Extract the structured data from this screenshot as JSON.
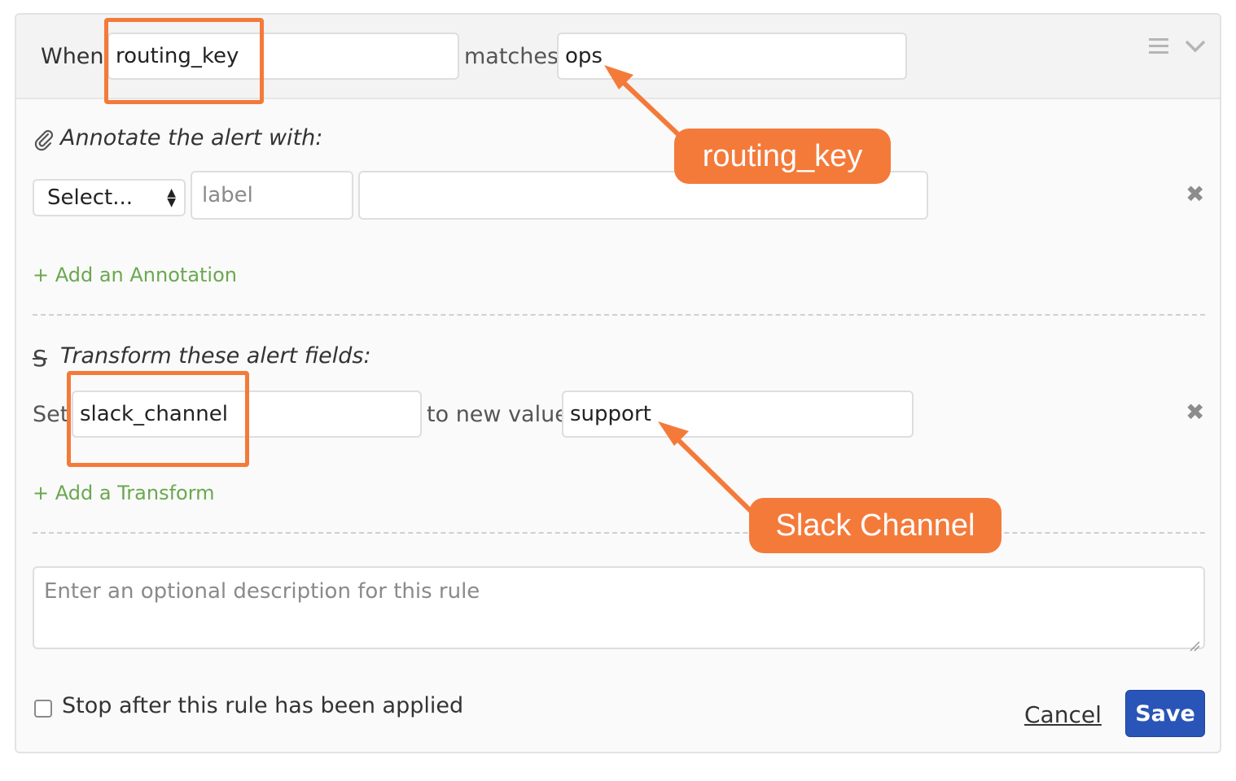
{
  "header": {
    "when_label": "When",
    "field_value": "routing_key",
    "matches_label": "matches",
    "match_value": "ops"
  },
  "annotate": {
    "title": "Annotate the alert with:",
    "select_value": "Select...",
    "label_placeholder": "label",
    "value_placeholder": "",
    "add_link": "+ Add an Annotation"
  },
  "transform": {
    "title": "Transform these alert fields:",
    "set_label": "Set",
    "field_value": "slack_channel",
    "to_label": "to new value",
    "new_value": "support",
    "add_link": "+ Add a Transform"
  },
  "description": {
    "placeholder": "Enter an optional description for this rule"
  },
  "footer": {
    "stop_label": "Stop after this rule has been applied",
    "stop_checked": false,
    "cancel_label": "Cancel",
    "save_label": "Save"
  },
  "callouts": {
    "routing_key": "routing_key",
    "slack_channel": "Slack Channel"
  },
  "icons": {
    "menu": "hamburger-menu-icon",
    "collapse": "chevron-down-icon",
    "annotate": "paperclip-icon",
    "transform": "strikethrough-s-icon",
    "remove": "close-icon"
  },
  "colors": {
    "highlight": "#f47a3a",
    "link_green": "#6aa84f",
    "save_button": "#2a55b8"
  }
}
